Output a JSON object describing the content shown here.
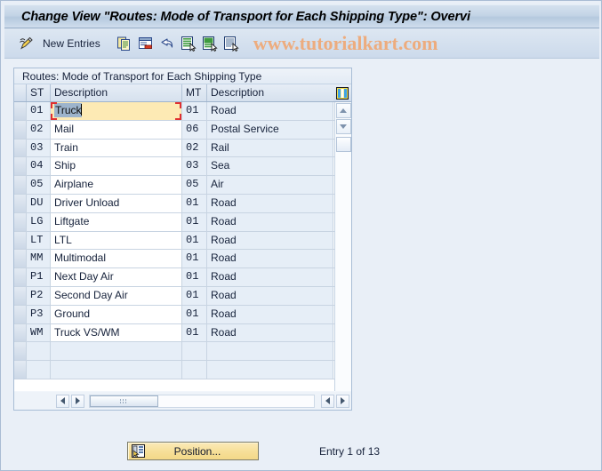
{
  "window": {
    "title": "Change View \"Routes: Mode of Transport for Each Shipping Type\": Overvi"
  },
  "toolbar": {
    "edit_icon": "pencil-icon",
    "new_entries_label": "New Entries",
    "buttons": [
      {
        "name": "copy-as-button",
        "icon": "copy-icon"
      },
      {
        "name": "delete-button",
        "icon": "delete-row-icon"
      },
      {
        "name": "undo-button",
        "icon": "undo-icon"
      },
      {
        "name": "select-all-button",
        "icon": "select-all-icon"
      },
      {
        "name": "deselect-all-button",
        "icon": "deselect-all-icon"
      },
      {
        "name": "details-button",
        "icon": "details-icon"
      }
    ],
    "watermark": "www.tutorialkart.com",
    "watermark_color": "#edac7e"
  },
  "table": {
    "caption": "Routes: Mode of Transport for Each Shipping Type",
    "columns": [
      {
        "key": "select",
        "label": ""
      },
      {
        "key": "st",
        "label": "ST"
      },
      {
        "key": "desc1",
        "label": "Description"
      },
      {
        "key": "mt",
        "label": "MT"
      },
      {
        "key": "desc2",
        "label": "Description"
      }
    ],
    "config_icon": "table-settings-icon",
    "rows": [
      {
        "st": "01",
        "desc1": "Truck",
        "mt": "01",
        "desc2": "Road",
        "editing": true
      },
      {
        "st": "02",
        "desc1": "Mail",
        "mt": "06",
        "desc2": "Postal Service",
        "editing": false
      },
      {
        "st": "03",
        "desc1": "Train",
        "mt": "02",
        "desc2": "Rail",
        "editing": false
      },
      {
        "st": "04",
        "desc1": "Ship",
        "mt": "03",
        "desc2": "Sea",
        "editing": false
      },
      {
        "st": "05",
        "desc1": "Airplane",
        "mt": "05",
        "desc2": "Air",
        "editing": false
      },
      {
        "st": "DU",
        "desc1": "Driver Unload",
        "mt": "01",
        "desc2": "Road",
        "editing": false
      },
      {
        "st": "LG",
        "desc1": "Liftgate",
        "mt": "01",
        "desc2": "Road",
        "editing": false
      },
      {
        "st": "LT",
        "desc1": "LTL",
        "mt": "01",
        "desc2": "Road",
        "editing": false
      },
      {
        "st": "MM",
        "desc1": "Multimodal",
        "mt": "01",
        "desc2": "Road",
        "editing": false
      },
      {
        "st": "P1",
        "desc1": "Next Day Air",
        "mt": "01",
        "desc2": "Road",
        "editing": false
      },
      {
        "st": "P2",
        "desc1": "Second Day Air",
        "mt": "01",
        "desc2": "Road",
        "editing": false
      },
      {
        "st": "P3",
        "desc1": "Ground",
        "mt": "01",
        "desc2": "Road",
        "editing": false
      },
      {
        "st": "WM",
        "desc1": "Truck VS/WM",
        "mt": "01",
        "desc2": "Road",
        "editing": false
      },
      {
        "st": "",
        "desc1": "",
        "mt": "",
        "desc2": "",
        "editing": false
      },
      {
        "st": "",
        "desc1": "",
        "mt": "",
        "desc2": "",
        "editing": false
      }
    ],
    "active_cell": {
      "row": 0,
      "column": "desc1",
      "value": "Truck",
      "selected_text": "Truck"
    }
  },
  "footer": {
    "position_button_label": "Position...",
    "position_button_icon": "position-icon",
    "entry_status": "Entry 1 of 13"
  }
}
